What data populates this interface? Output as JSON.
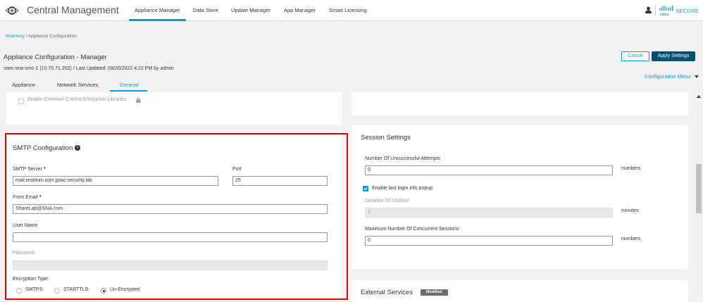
{
  "app": {
    "title": "Central Management",
    "brand_text": "SECURE"
  },
  "nav": {
    "items": [
      "Appliance Manager",
      "Data Store",
      "Update Manager",
      "App Manager",
      "Smart Licensing"
    ]
  },
  "breadcrumb": {
    "link": "Inventory",
    "separator": "/",
    "current": "Appliance Configuration"
  },
  "page": {
    "title": "Appliance Configuration - Manager",
    "subtitle": "vsec-sna-smc-1 (10.70.71.202) / Last Updated: 09/20/2022 4:22 PM by admin"
  },
  "actions": {
    "cancel": "Cancel",
    "apply": "Apply Settings",
    "config_menu": "Configuration Menu"
  },
  "tabs": [
    "Appliance",
    "Network Services",
    "General"
  ],
  "top_left_panel": {
    "checkbox_label": "Enable Common Criteria Encryption Libraries",
    "checked": false
  },
  "smtp": {
    "title": "SMTP Configuration",
    "server_label": "SMTP Server",
    "server_value": "mail.testdom.com.jptac-security.lab",
    "port_label": "Port",
    "port_value": "25",
    "from_label": "From Email",
    "from_value": "ShareLab@SNA.com",
    "user_label": "User Name",
    "user_value": "",
    "password_label": "Password",
    "encryption_label": "Encryption Type",
    "encryption_options": [
      "SMTPS",
      "STARTTLS",
      "Un-Encrypted"
    ],
    "encryption_selected": "Un-Encrypted",
    "required_mark": "*"
  },
  "session": {
    "title": "Session Settings",
    "attempts_label": "Number Of Unsuccessful Attempts",
    "attempts_value": "0",
    "attempts_unit": "numbers",
    "last_login_label": "Enable last login info popup",
    "last_login_checked": true,
    "lockout_label": "Duration Of Lockout",
    "lockout_value": "1",
    "lockout_unit": "minutes",
    "concurrent_label": "Maximum Number Of Concurrent Sessions",
    "concurrent_value": "0",
    "concurrent_unit": "numbers"
  },
  "external": {
    "title": "External Services",
    "badge": "Modified"
  },
  "colors": {
    "accent": "#049fd9",
    "primary_button": "#005073",
    "highlight": "#e00000",
    "badge": "#6d6d6d"
  }
}
